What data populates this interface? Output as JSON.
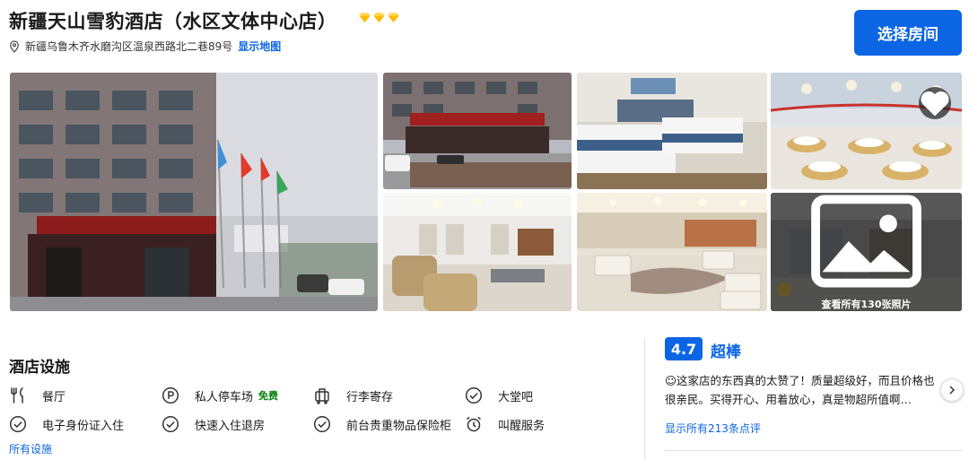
{
  "hotel": {
    "name": "新疆天山雪豹酒店（水区文体中心店）",
    "star_color": "#febb02",
    "address": "新疆乌鲁木齐水磨沟区温泉西路北二巷89号",
    "show_map_label": "显示地图"
  },
  "book_button": {
    "label": "选择房间",
    "color": "#0c66e4"
  },
  "gallery": {
    "photos": [
      {
        "icon": "hotel-exterior-photo"
      },
      {
        "icon": "hotel-entrance-photo"
      },
      {
        "icon": "twin-room-photo"
      },
      {
        "icon": "banquet-hall-photo"
      },
      {
        "icon": "lobby-lounge-photo"
      },
      {
        "icon": "lounge-seating-photo"
      },
      {
        "icon": "lobby-reception-photo"
      }
    ],
    "view_all_label": "查看所有130张照片"
  },
  "facilities": {
    "title": "酒店设施",
    "items": [
      {
        "label": "餐厅",
        "icon": "restaurant-icon"
      },
      {
        "label": "私人停车场",
        "icon": "parking-icon",
        "badge": "免费"
      },
      {
        "label": "行李寄存",
        "icon": "luggage-icon"
      },
      {
        "label": "大堂吧",
        "icon": "check-circle-icon"
      },
      {
        "label": "电子身份证入住",
        "icon": "check-circle-icon"
      },
      {
        "label": "快速入住退房",
        "icon": "check-circle-icon"
      },
      {
        "label": "前台贵重物品保险柜",
        "icon": "check-circle-icon"
      },
      {
        "label": "叫醒服务",
        "icon": "alarm-clock-icon"
      }
    ],
    "all_label": "所有设施"
  },
  "review": {
    "score": "4.7",
    "score_label": "超棒",
    "text": "☺这家店的东西真的太赞了！质量超级好，而且价格也很亲民。买得开心、用着放心，真是物超所值啊…",
    "all_reviews_label": "显示所有213条点评",
    "accent_color": "#0c66e4"
  }
}
